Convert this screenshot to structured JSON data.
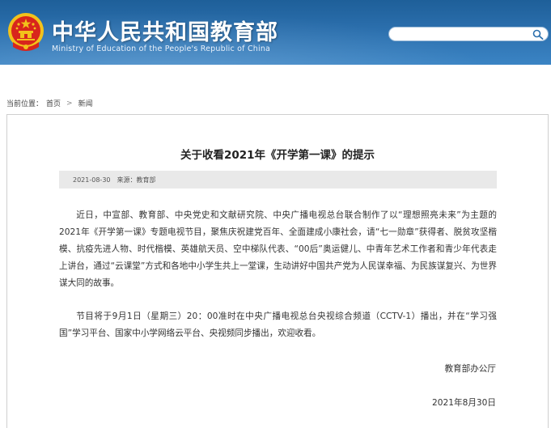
{
  "header": {
    "title": "中华人民共和国教育部",
    "subtitle": "Ministry of Education of the People's Republic of China",
    "emblem_icon": "national-emblem-icon",
    "colors": {
      "header_blue": "#2b6fad",
      "emblem_red": "#d8261c",
      "emblem_gold": "#f2c21b"
    }
  },
  "search": {
    "value": "",
    "placeholder": "",
    "button_icon": "search-icon"
  },
  "breadcrumb": {
    "prefix": "当前位置：",
    "home": "首页",
    "separator": ">",
    "current": "新闻"
  },
  "article": {
    "title": "关于收看2021年《开学第一课》的提示",
    "date": "2021-08-30",
    "source": "来源：教育部",
    "paragraphs": [
      "近日，中宣部、教育部、中央党史和文献研究院、中央广播电视总台联合制作了以“理想照亮未来”为主题的2021年《开学第一课》专题电视节目，聚焦庆祝建党百年、全面建成小康社会，请“七一勋章”获得者、脱贫攻坚楷模、抗疫先进人物、时代楷模、英雄航天员、空中梯队代表、“00后”奥运健儿、中青年艺术工作者和青少年代表走上讲台，通过“云课堂”方式和各地中小学生共上一堂课，生动讲好中国共产党为人民谋幸福、为民族谋复兴、为世界谋大同的故事。",
      "节目将于9月1日（星期三）20：00准时在中央广播电视总台央视综合频道（CCTV-1）播出，并在“学习强国”学习平台、国家中小学网络云平台、央视频同步播出，欢迎收看。"
    ],
    "signature": "教育部办公厅",
    "signed_date": "2021年8月30日"
  }
}
